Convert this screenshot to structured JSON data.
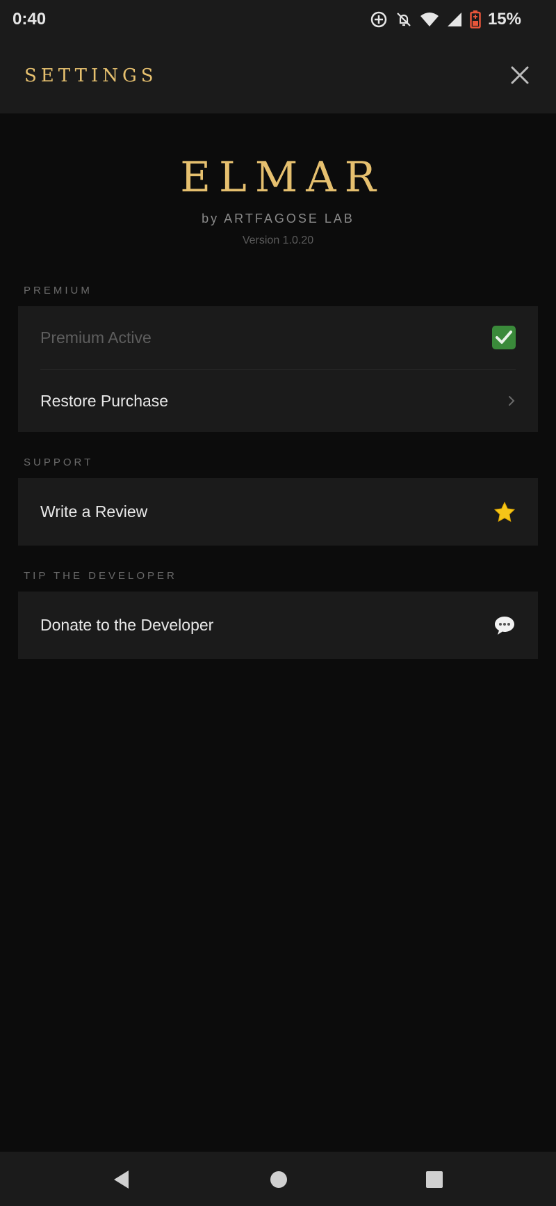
{
  "status_bar": {
    "time": "0:40",
    "battery_percent": "15%",
    "icons": [
      "data-saver-icon",
      "notifications-off-icon",
      "wifi-icon",
      "cell-signal-icon",
      "battery-low-icon"
    ]
  },
  "header": {
    "title": "SETTINGS",
    "close_icon": "close-icon"
  },
  "brand": {
    "name": "ELMAR",
    "by": "by ARTFAGOSE LAB",
    "version": "Version 1.0.20"
  },
  "sections": {
    "premium": {
      "label": "PREMIUM",
      "items": [
        {
          "label": "Premium Active",
          "icon": "check-mark-icon"
        },
        {
          "label": "Restore Purchase",
          "icon": "chevron-right-icon"
        }
      ]
    },
    "support": {
      "label": "SUPPORT",
      "items": [
        {
          "label": "Write a Review",
          "icon": "star-icon"
        }
      ]
    },
    "tip": {
      "label": "TIP THE DEVELOPER",
      "items": [
        {
          "label": "Donate to the Developer",
          "icon": "speech-bubble-icon"
        }
      ]
    }
  },
  "nav_bar": {
    "icons": [
      "back-icon",
      "home-icon",
      "recents-icon"
    ]
  },
  "colors": {
    "accent_gold": "#e6c06f",
    "background": "#0c0c0c",
    "surface": "#1b1b1b",
    "check_green": "#3a8a3a",
    "star_yellow": "#f5c518",
    "battery_red": "#e8553a"
  }
}
